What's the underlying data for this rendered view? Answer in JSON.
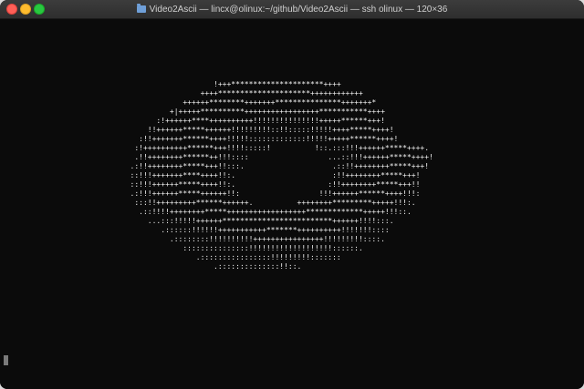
{
  "window": {
    "title": "Video2Ascii — lincx@olinux:~/github/Video2Ascii — ssh olinux — 120×36",
    "folder_icon": "folder-icon"
  },
  "terminal": {
    "ascii_lines": [
      "                           !+++*********************++++",
      "                        ++++*********************++++++++++++",
      "                    ++++++********+++++++***************+++++++*",
      "                 +|+++++**********+++++++++++++++++***********++++",
      "              :!++++++****++++++++++!!!!!!!!!!!!!!!+++++******+++!",
      "            !!++++++*****++++++!!!!!!!!!::!!:::::!!!!!++++*****++++!",
      "          :!!+++++++******++++!!!!!:::::::::::::!!!!!+++++******++++!",
      "         :!++++++++++******+++!!!!:::::!          !::.:::!!!++++++*****++++.",
      "         .!!++++++++******++!!!::::                  ...::!!!++++++*****++++!",
      "        .:!!++++++++*****+++!!:::.                    .::!!++++++++*****+++!",
      "        ::!!!+++++++****++++!!:.                      :!!++++++++*****+++!",
      "        ::!!!++++++*****++++!!:.                     :!!++++++++*****+++!!",
      "        .:!!!++++++*****++++++!!:                  !!!++++++******++++!!!:",
      "         :::!!+++++++++******++++++.          ++++++++*********+++++!!!:.",
      "          .::!!!!++++++++*****++++++++++++++++++*************+++++!!!::.",
      "            ...:::!!!!!++++++*************************++++++!!!!:::.",
      "               .::::::!!!!!!+++++++++++*******++++++++++!!!!!!!::::",
      "                 .::::::::!!!!!!!!!!++++++++++++++++!!!!!!!!!::::.",
      "                    :::::::::::::::!!!!!!!!!!!!!!!!!!!::::::.",
      "                       .::::::::::::::::!!!!!!!!!:::::::",
      "                           .::::::::::::::!!::."
    ]
  }
}
